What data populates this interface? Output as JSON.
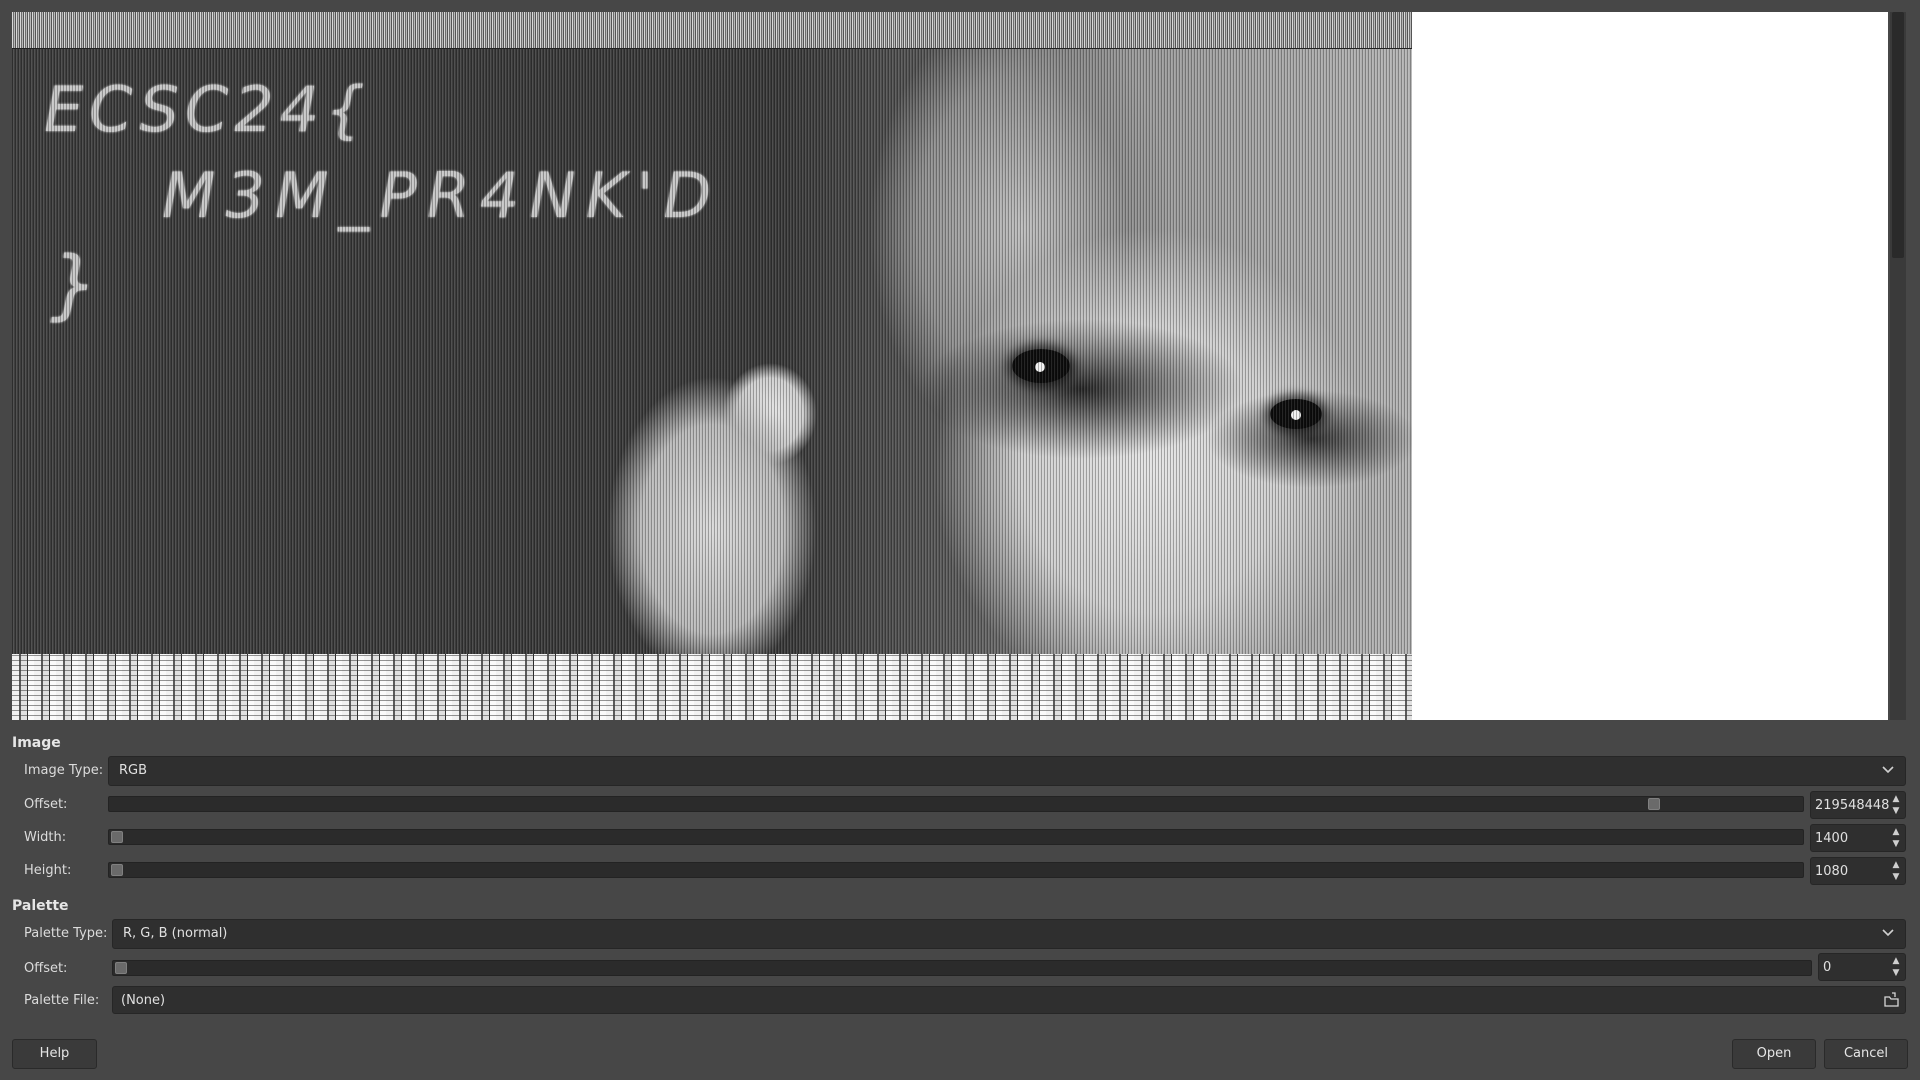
{
  "preview": {
    "chalk_line1": "ECSC24{",
    "chalk_line2": "M3M_PR4NK'D",
    "chalk_line3": "}"
  },
  "image_section": {
    "title": "Image",
    "image_type": {
      "label": "Image Type:",
      "value": "RGB"
    },
    "offset": {
      "label": "Offset:",
      "value": "219548448",
      "fraction": 0.915
    },
    "width": {
      "label": "Width:",
      "value": "1400",
      "fraction": 0.0
    },
    "height": {
      "label": "Height:",
      "value": "1080",
      "fraction": 0.0
    }
  },
  "palette_section": {
    "title": "Palette",
    "palette_type": {
      "label": "Palette Type:",
      "value": "R, G, B (normal)"
    },
    "offset": {
      "label": "Offset:",
      "value": "0",
      "fraction": 0.0
    },
    "palette_file": {
      "label": "Palette File:",
      "value": "(None)"
    }
  },
  "buttons": {
    "help": "Help",
    "open": "Open",
    "cancel": "Cancel"
  },
  "icons": {
    "chevron": "chevron-down-icon",
    "spin_up": "arrow-up-icon",
    "spin_down": "arrow-down-icon",
    "file_open": "folder-open-icon"
  }
}
